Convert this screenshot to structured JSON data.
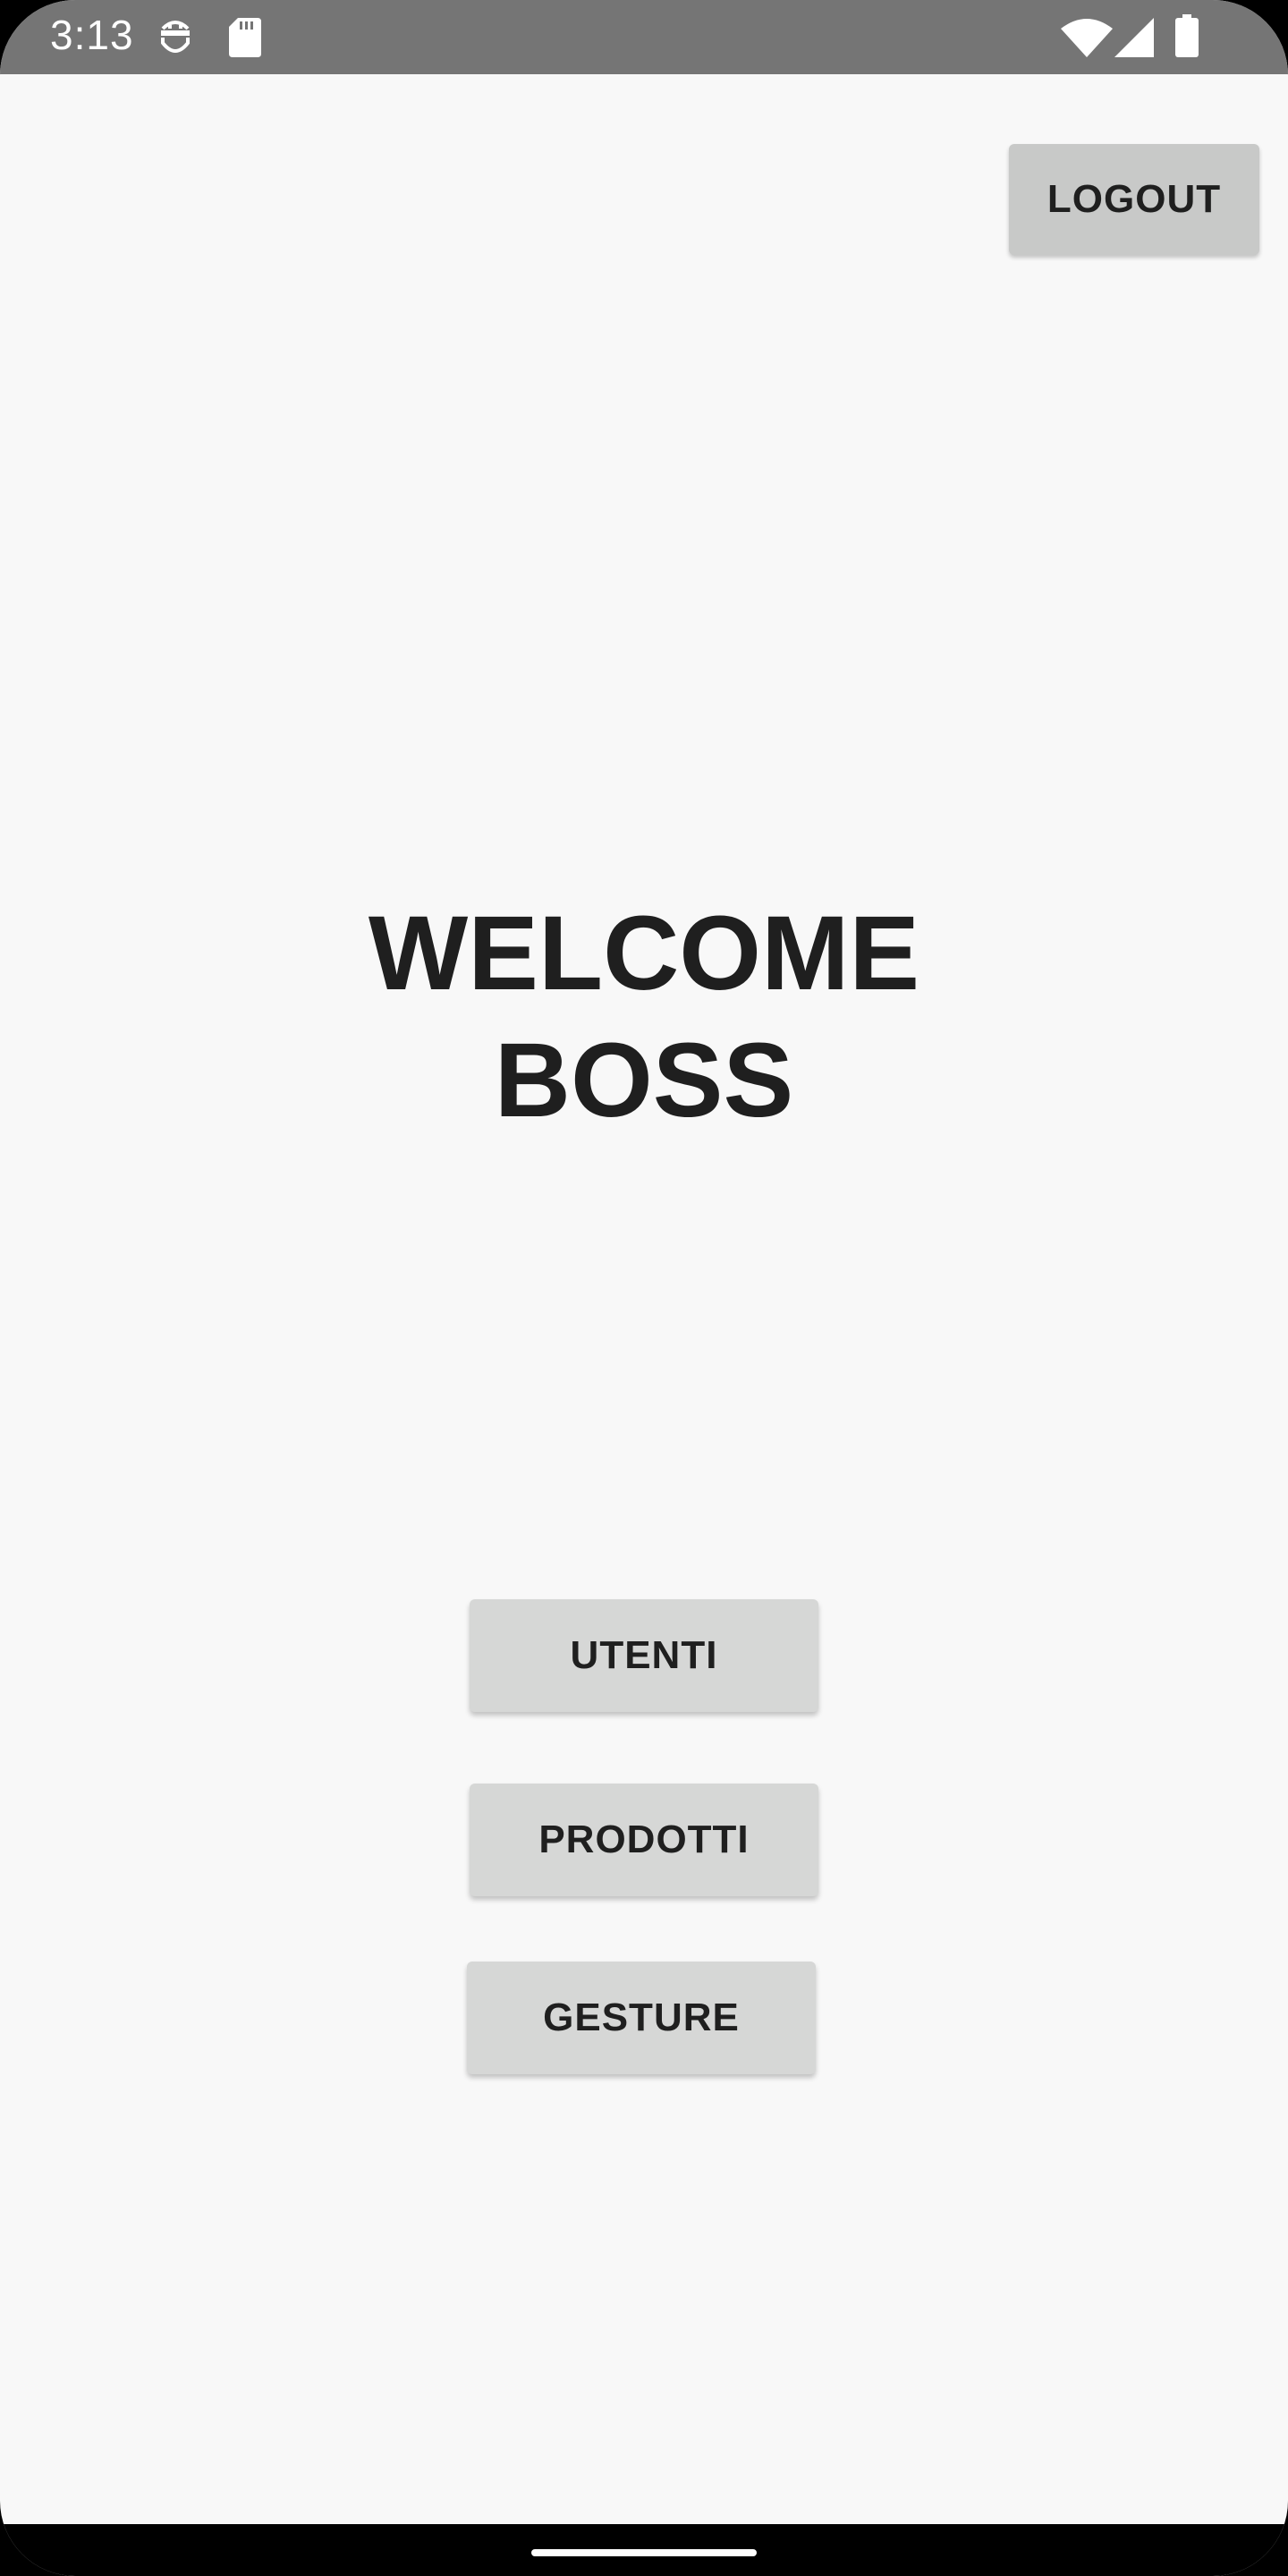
{
  "status_bar": {
    "time": "3:13",
    "icons": [
      "android-debug-icon",
      "sd-card-icon",
      "wifi-icon",
      "cell-signal-icon",
      "battery-icon"
    ],
    "background": "#757575"
  },
  "header": {
    "logout_label": "LOGOUT"
  },
  "main": {
    "title_line1": "WELCOME",
    "title_line2": "BOSS",
    "buttons": [
      {
        "label": "UTENTI"
      },
      {
        "label": "PRODOTTI"
      },
      {
        "label": "GESTURE"
      }
    ]
  },
  "colors": {
    "background": "#f8f8f8",
    "button": "#d6d7d6",
    "text": "#1f1f1f"
  }
}
